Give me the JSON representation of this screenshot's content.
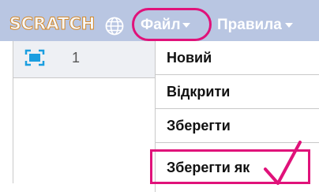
{
  "menubar": {
    "logo_text": "SCRATCH",
    "globe_icon": "globe-icon",
    "file_label": "Файл",
    "rules_label": "Правила",
    "background": "#b9c6e2"
  },
  "left_panel": {
    "screen_icon": "screen-icon",
    "row_number": "1"
  },
  "file_menu": {
    "items": [
      {
        "label": "Новий"
      },
      {
        "label": "Відкрити"
      },
      {
        "label": "Зберегти"
      },
      {
        "label": "Зберегти як"
      }
    ],
    "highlighted_item": "Зберегти як"
  },
  "annotation": {
    "color": "#e0127a",
    "checkmark_icon": "checkmark-icon"
  }
}
